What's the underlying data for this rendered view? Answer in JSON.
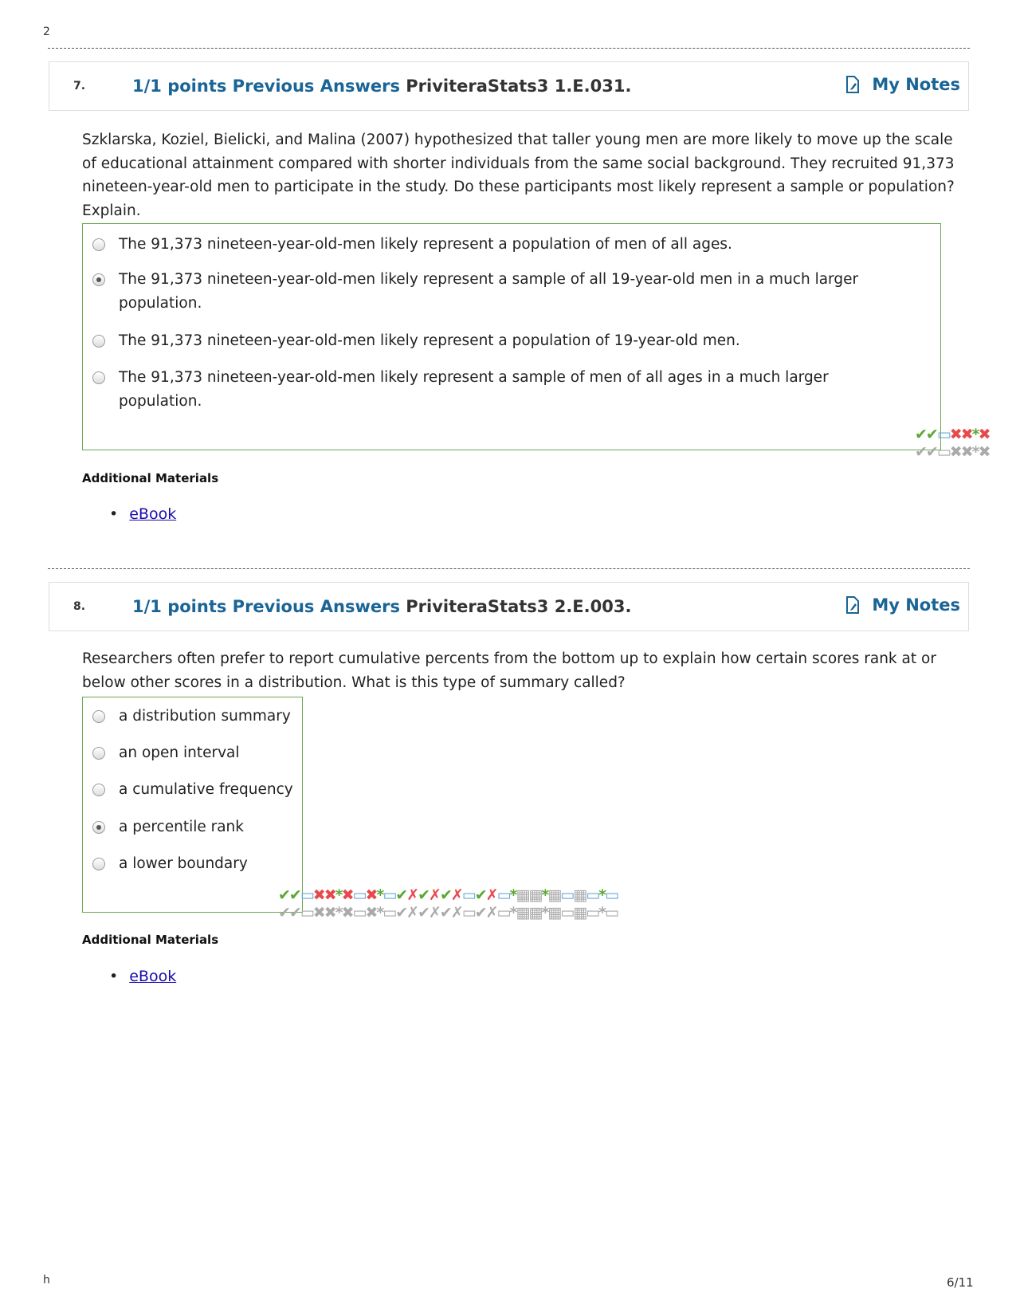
{
  "page": {
    "top_corner": "2",
    "bottom_corner": "h",
    "page_number": "6/11"
  },
  "questions": [
    {
      "number": "7.",
      "points": "1/1 points",
      "previous_answers": "Previous Answers",
      "code": "PriviteraStats3 1.E.031.",
      "my_notes": "My Notes",
      "stem": "Szklarska, Koziel, Bielicki, and Malina (2007) hypothesized that taller young men are more likely to move up the scale of educational attainment compared with shorter individuals from the same social background. They recruited 91,373 nineteen-year-old men to participate in the study. Do these participants most likely represent a sample or population? Explain.",
      "options": [
        {
          "label": "The 91,373 nineteen-year-old-men likely represent a population of men of all ages.",
          "selected": false
        },
        {
          "label": "The 91,373 nineteen-year-old-men likely represent a sample of all 19-year-old men in a much larger population.",
          "selected": true
        },
        {
          "label": "The 91,373 nineteen-year-old-men likely represent a population of 19-year-old men.",
          "selected": false
        },
        {
          "label": "The 91,373 nineteen-year-old-men likely represent a sample of men of all ages in a much larger population.",
          "selected": false
        }
      ],
      "additional_materials": "Additional Materials",
      "ebook": "eBook"
    },
    {
      "number": "8.",
      "points": "1/1 points",
      "previous_answers": "Previous Answers",
      "code": "PriviteraStats3 2.E.003.",
      "my_notes": "My Notes",
      "stem": "Researchers often prefer to report cumulative percents from the bottom up to explain how certain scores rank at or below other scores in a distribution. What is this type of summary called?",
      "options": [
        {
          "label": "a distribution summary",
          "selected": false
        },
        {
          "label": "an open interval",
          "selected": false
        },
        {
          "label": "a cumulative frequency",
          "selected": false
        },
        {
          "label": "a percentile rank",
          "selected": true
        },
        {
          "label": "a lower boundary",
          "selected": false
        }
      ],
      "additional_materials": "Additional Materials",
      "ebook": "eBook"
    }
  ],
  "colors": {
    "accent": "#1a6496",
    "answer_border": "#6aa84f",
    "correct": "#5aa832",
    "incorrect": "#e8474c"
  }
}
